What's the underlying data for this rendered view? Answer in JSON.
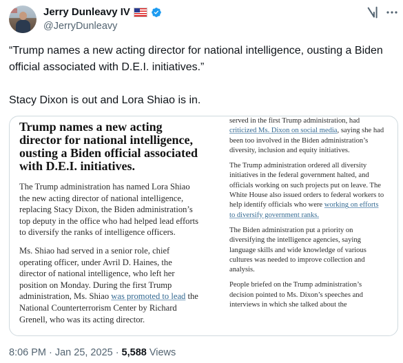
{
  "author": {
    "name": "Jerry Dunleavy IV",
    "flag": "🇺🇸",
    "handle": "@JerryDunleavy",
    "avatar_icon": "avatar-photo",
    "verified_icon": "verified-badge-icon"
  },
  "header_icons": [
    "grok-icon",
    "more-icon"
  ],
  "tweet": {
    "line1": "“Trump names a new acting director for national intelligence, ousting a Biden official associated with D.E.I. initiatives.”",
    "line2": "Stacy Dixon is out and Lora Shiao is in."
  },
  "article": {
    "headline": "Trump names a new acting director for national intelligence, ousting a Biden official associated with D.E.I. initiatives.",
    "left": {
      "p1": "The Trump administration has named Lora Shiao the new acting director of national intelligence, replacing Stacy Dixon, the Biden administration’s top deputy in the office who had helped lead efforts to diversify the ranks of intelligence officers.",
      "p2_a": "Ms. Shiao had served in a senior role, chief operating officer, under Avril D. Haines, the director of national intelligence, who left her position on Monday. During the first Trump administration, Ms. Shiao ",
      "p2_link": "was promoted to lead",
      "p2_b": " the National Counterterrorism Center by Richard Grenell, who was its acting director."
    },
    "right": {
      "p1_a": "served in the first Trump administration, had ",
      "p1_link": "criticized Ms. Dixon on social media",
      "p1_b": ", saying she had been too involved in the Biden administration’s diversity, inclusion and equity initiatives.",
      "p2_a": "The Trump administration ordered all diversity initiatives in the federal government halted, and officials working on such projects put on leave. The White House also issued orders to federal workers to help identify officials who were ",
      "p2_link": "working on efforts to diversify government ranks.",
      "p3": "The Biden administration put a priority on diversifying the intelligence agencies, saying language skills and wide knowledge of various cultures was needed to improve collection and analysis.",
      "p4": "People briefed on the Trump administration’s decision pointed to Ms. Dixon’s speeches and interviews in which she talked about the"
    }
  },
  "meta": {
    "time": "8:06 PM",
    "separator": "·",
    "date": "Jan 25, 2025",
    "views_count": "5,588",
    "views_label": "Views"
  }
}
